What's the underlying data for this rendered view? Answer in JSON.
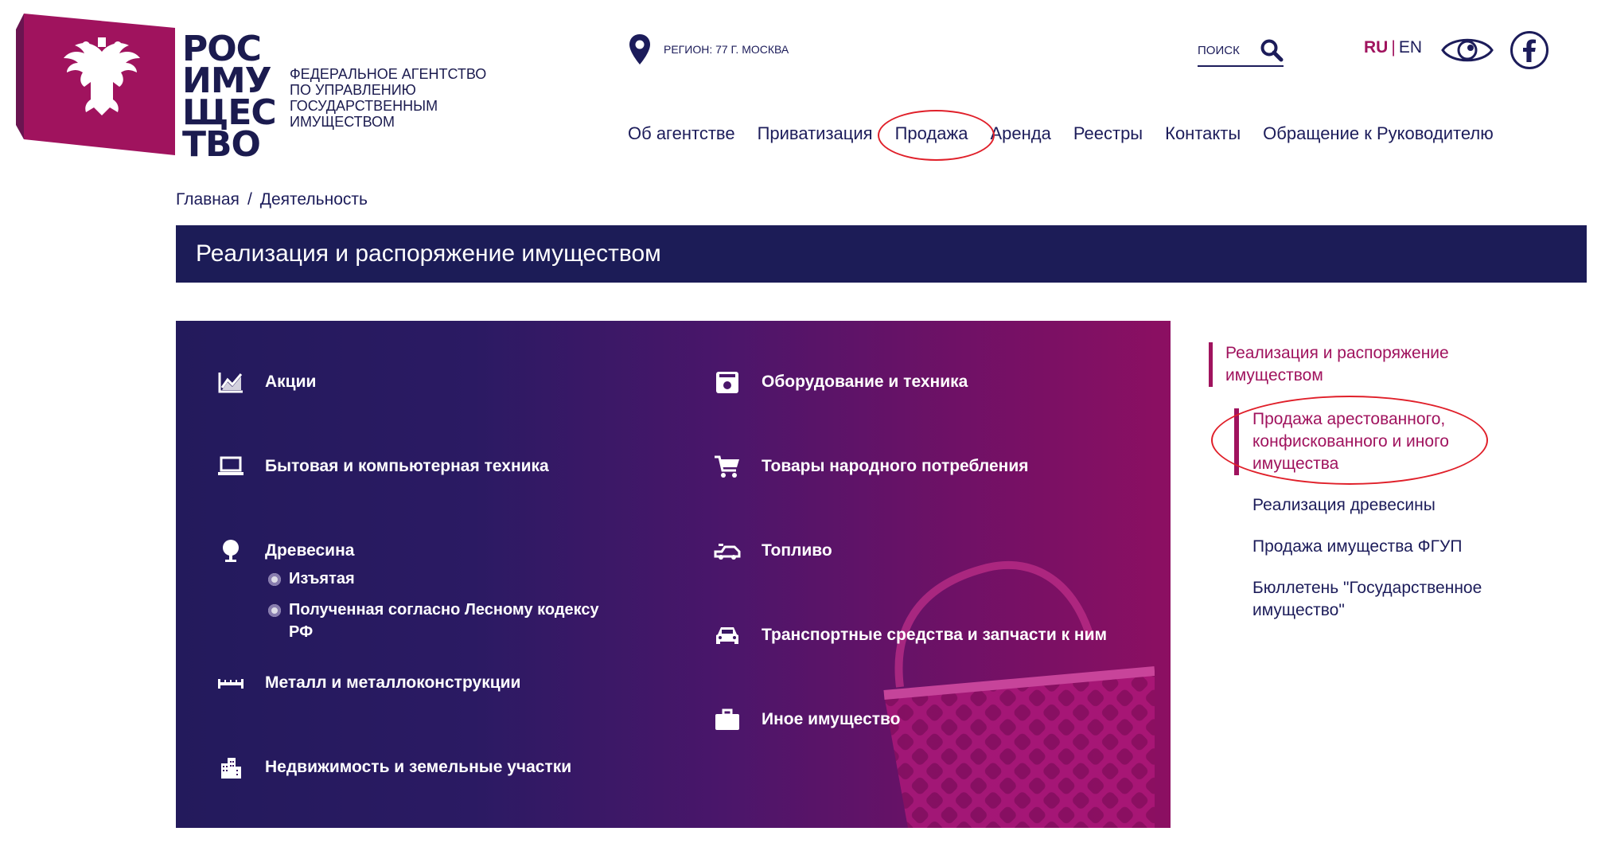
{
  "logo": {
    "word_lines": [
      "РОС",
      "ИМУ",
      "ЩЕС",
      "ТВО"
    ],
    "subtitle_lines": [
      "ФЕДЕРАЛЬНОЕ АГЕНТСТВО",
      "ПО УПРАВЛЕНИЮ",
      "ГОСУДАРСТВЕННЫМ",
      "ИМУЩЕСТВОМ"
    ],
    "flag_color": "#a0135e",
    "flag_side_color": "#6a1450",
    "emblem_icon": "double-headed-eagle-icon"
  },
  "topbar": {
    "region_label": "РЕГИОН: 77 Г. МОСКВА",
    "region_icon": "location-pin-icon",
    "search_label": "ПОИСК",
    "search_icon": "magnifier-icon",
    "lang_ru": "RU",
    "lang_sep": "|",
    "lang_en": "EN",
    "accessibility_icon": "eye-icon",
    "social_icon": "facebook-icon"
  },
  "nav": {
    "items": [
      "Об агентстве",
      "Приватизация",
      "Продажа",
      "Аренда",
      "Реестры",
      "Контакты",
      "Обращение к Руководителю"
    ],
    "highlighted": "Продажа"
  },
  "breadcrumb": {
    "home": "Главная",
    "separator": "/",
    "current": "Деятельность"
  },
  "page_title": "Реализация и распоряжение имуществом",
  "categories": {
    "left": [
      {
        "label": "Акции",
        "icon": "stock-chart-icon"
      },
      {
        "label": "Бытовая и компьютерная техника",
        "icon": "laptop-icon"
      },
      {
        "label": "Древесина",
        "icon": "tree-icon"
      },
      {
        "label": "Металл и металлоконструкции",
        "icon": "metal-beam-icon"
      },
      {
        "label": "Недвижимость и земельные участки",
        "icon": "building-icon"
      }
    ],
    "wood_subitems": [
      "Изъятая",
      "Полученная согласно Лесному кодексу",
      "РФ"
    ],
    "right": [
      {
        "label": "Оборудование и техника",
        "icon": "equipment-icon"
      },
      {
        "label": "Товары народного потребления",
        "icon": "shopping-cart-icon"
      },
      {
        "label": "Топливо",
        "icon": "fuel-icon"
      },
      {
        "label": "Транспортные средства и запчасти к ним",
        "icon": "car-icon"
      },
      {
        "label": "Иное имущество",
        "icon": "briefcase-icon"
      }
    ],
    "gradient_start": "#231a5c",
    "gradient_end": "#8c0f62"
  },
  "side_menu": {
    "title_lines": [
      "Реализация и распоряжение",
      "имуществом"
    ],
    "active_lines": [
      "Продажа арестованного,",
      "конфискованного и иного",
      "имущества"
    ],
    "links": [
      {
        "lines": [
          "Реализация древесины"
        ]
      },
      {
        "lines": [
          "Продажа имущества ФГУП"
        ]
      },
      {
        "lines": [
          "Бюллетень \"Государственное",
          "имущество\""
        ]
      }
    ],
    "accent": "#a0135e",
    "annotation_color": "#e0202a"
  }
}
